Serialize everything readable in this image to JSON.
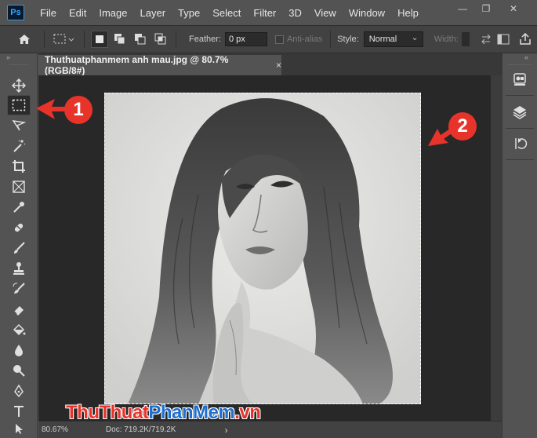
{
  "app": {
    "logo_text": "Ps"
  },
  "menu": [
    "File",
    "Edit",
    "Image",
    "Layer",
    "Type",
    "Select",
    "Filter",
    "3D",
    "View",
    "Window",
    "Help"
  ],
  "window_controls": {
    "minimize": "—",
    "restore": "❐",
    "close": "✕"
  },
  "options": {
    "feather_label": "Feather:",
    "feather_value": "0 px",
    "antialias_label": "Anti-alias",
    "style_label": "Style:",
    "style_value": "Normal",
    "width_label": "Width:"
  },
  "tools": [
    "move-tool",
    "rectangular-marquee-tool",
    "lasso-tool",
    "magic-wand-tool",
    "crop-tool",
    "frame-tool",
    "eyedropper-tool",
    "healing-brush-tool",
    "brush-tool",
    "clone-stamp-tool",
    "history-brush-tool",
    "eraser-tool",
    "paint-bucket-tool",
    "blur-tool",
    "dodge-tool",
    "pen-tool",
    "type-tool",
    "path-selection-tool"
  ],
  "document": {
    "tab_title": "Thuthuatphanmem anh mau.jpg @ 80.7% (RGB/8#)",
    "close": "×"
  },
  "status": {
    "zoom": "80.67%",
    "doc_info": "Doc: 719.2K/719.2K",
    "arrow": "›"
  },
  "annotations": {
    "badge1": "1",
    "badge2": "2"
  },
  "watermark": {
    "part1": "Thu",
    "part2": "Thuat",
    "part3": "Phan",
    "part4": "Mem",
    "part5": ".vn"
  },
  "colors": {
    "annotation_red": "#e8332a",
    "ui_dark": "#535353",
    "canvas_bg": "#282828"
  }
}
